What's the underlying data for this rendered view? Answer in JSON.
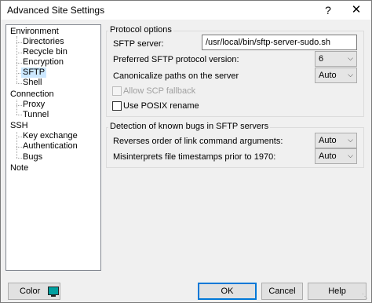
{
  "window": {
    "title": "Advanced Site Settings",
    "help_label": "?",
    "close_label": "✕"
  },
  "tree": {
    "items": [
      {
        "label": "Environment",
        "level": 0
      },
      {
        "label": "Directories",
        "level": 1
      },
      {
        "label": "Recycle bin",
        "level": 1
      },
      {
        "label": "Encryption",
        "level": 1
      },
      {
        "label": "SFTP",
        "level": 1,
        "selected": true
      },
      {
        "label": "Shell",
        "level": 1
      },
      {
        "label": "Connection",
        "level": 0
      },
      {
        "label": "Proxy",
        "level": 1
      },
      {
        "label": "Tunnel",
        "level": 1
      },
      {
        "label": "SSH",
        "level": 0
      },
      {
        "label": "Key exchange",
        "level": 1
      },
      {
        "label": "Authentication",
        "level": 1
      },
      {
        "label": "Bugs",
        "level": 1
      },
      {
        "label": "Note",
        "level": 0
      }
    ]
  },
  "protocol": {
    "legend": "Protocol options",
    "server_label": "SFTP server:",
    "server_value": "/usr/local/bin/sftp-server-sudo.sh",
    "version_label": "Preferred SFTP protocol version:",
    "version_value": "6",
    "canon_label": "Canonicalize paths on the server",
    "canon_value": "Auto",
    "scp_label": "Allow SCP fallback",
    "scp_checked": false,
    "scp_enabled": false,
    "posix_label": "Use POSIX rename",
    "posix_checked": false
  },
  "bugs": {
    "legend": "Detection of known bugs in SFTP servers",
    "symlink_label": "Reverses order of link command arguments:",
    "symlink_value": "Auto",
    "timestamps_label": "Misinterprets file timestamps prior to 1970:",
    "timestamps_value": "Auto"
  },
  "footer": {
    "color_label": "Color",
    "ok_label": "OK",
    "cancel_label": "Cancel",
    "help_label": "Help"
  },
  "icons": {
    "dropdown": "chevron-down-icon",
    "color": "monitor-icon"
  }
}
